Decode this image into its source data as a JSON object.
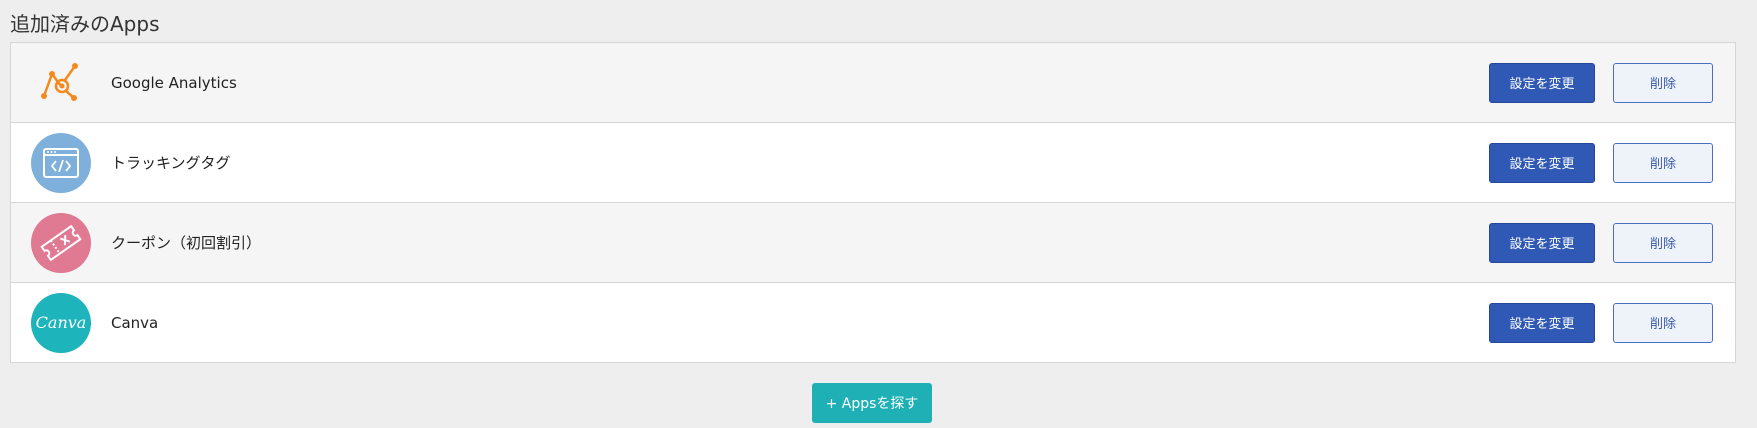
{
  "section": {
    "title": "追加済みのApps"
  },
  "apps": [
    {
      "name": "Google Analytics",
      "icon": "google-analytics-icon",
      "icon_bg": "transparent",
      "edit_label": "設定を変更",
      "delete_label": "削除"
    },
    {
      "name": "トラッキングタグ",
      "icon": "code-window-icon",
      "icon_bg": "#7fb0dc",
      "edit_label": "設定を変更",
      "delete_label": "削除"
    },
    {
      "name": "クーポン（初回割引）",
      "icon": "coupon-ticket-icon",
      "icon_bg": "#e07a92",
      "edit_label": "設定を変更",
      "delete_label": "削除"
    },
    {
      "name": "Canva",
      "icon": "canva-logo-icon",
      "icon_bg": "#1db4bc",
      "icon_text": "Canva",
      "edit_label": "設定を変更",
      "delete_label": "削除"
    }
  ],
  "add_button": {
    "label": "+ Appsを探す"
  },
  "colors": {
    "primary": "#2f59b4",
    "secondary_border": "#4a6fc1",
    "add_button": "#1eb0b4",
    "analytics_orange": "#f48a1e"
  }
}
